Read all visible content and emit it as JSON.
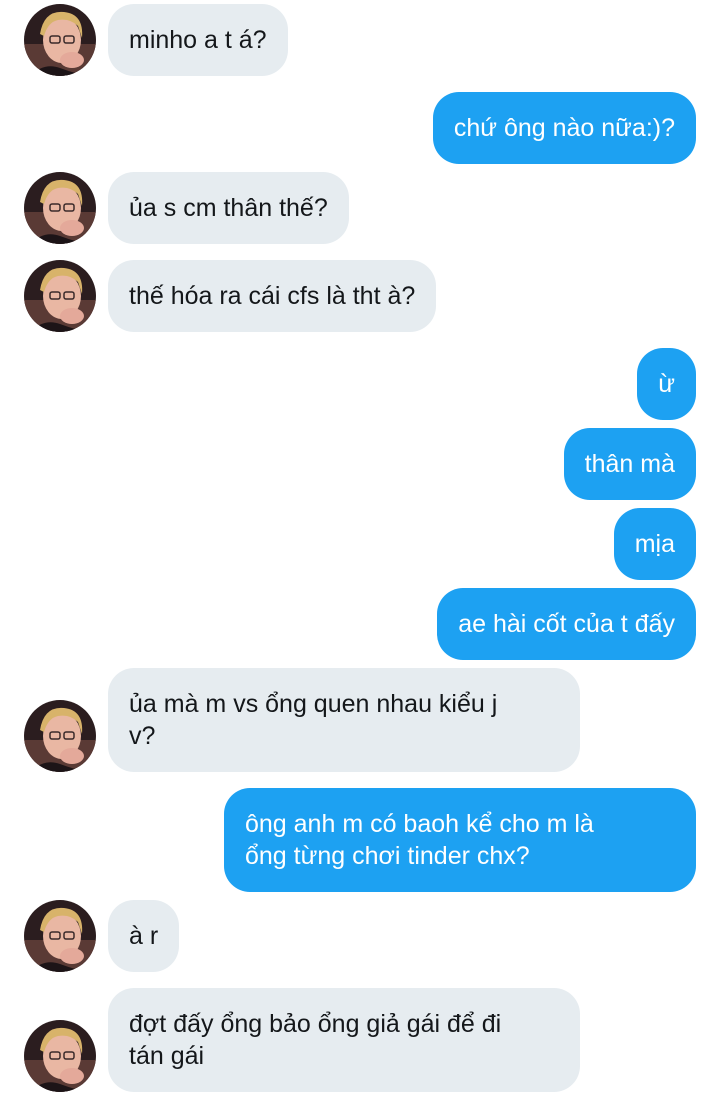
{
  "conversation": {
    "colors": {
      "incoming_bubble": "#e6ecf0",
      "outgoing_bubble": "#1da1f2",
      "incoming_text": "#14171a",
      "outgoing_text": "#ffffff"
    },
    "messages": [
      {
        "from": "contact",
        "text": "minho a t á?"
      },
      {
        "from": "me",
        "text": "chứ ông nào nữa:)?"
      },
      {
        "from": "contact",
        "text": "ủa s cm thân thế?"
      },
      {
        "from": "contact",
        "text": "thế hóa ra cái cfs là tht à?"
      },
      {
        "from": "me",
        "text": "ừ"
      },
      {
        "from": "me",
        "text": "thân mà"
      },
      {
        "from": "me",
        "text": "mịa"
      },
      {
        "from": "me",
        "text": "ae hài cốt của t đấy"
      },
      {
        "from": "contact",
        "text": "ủa mà m vs ổng quen nhau kiểu j\nv?"
      },
      {
        "from": "me",
        "text": "ông anh m có baoh kể cho m là\nổng từng chơi tinder chx?"
      },
      {
        "from": "contact",
        "text": "à r"
      },
      {
        "from": "contact",
        "text": "đợt đấy ổng bảo ổng giả gái để đi\ntán gái"
      }
    ]
  }
}
